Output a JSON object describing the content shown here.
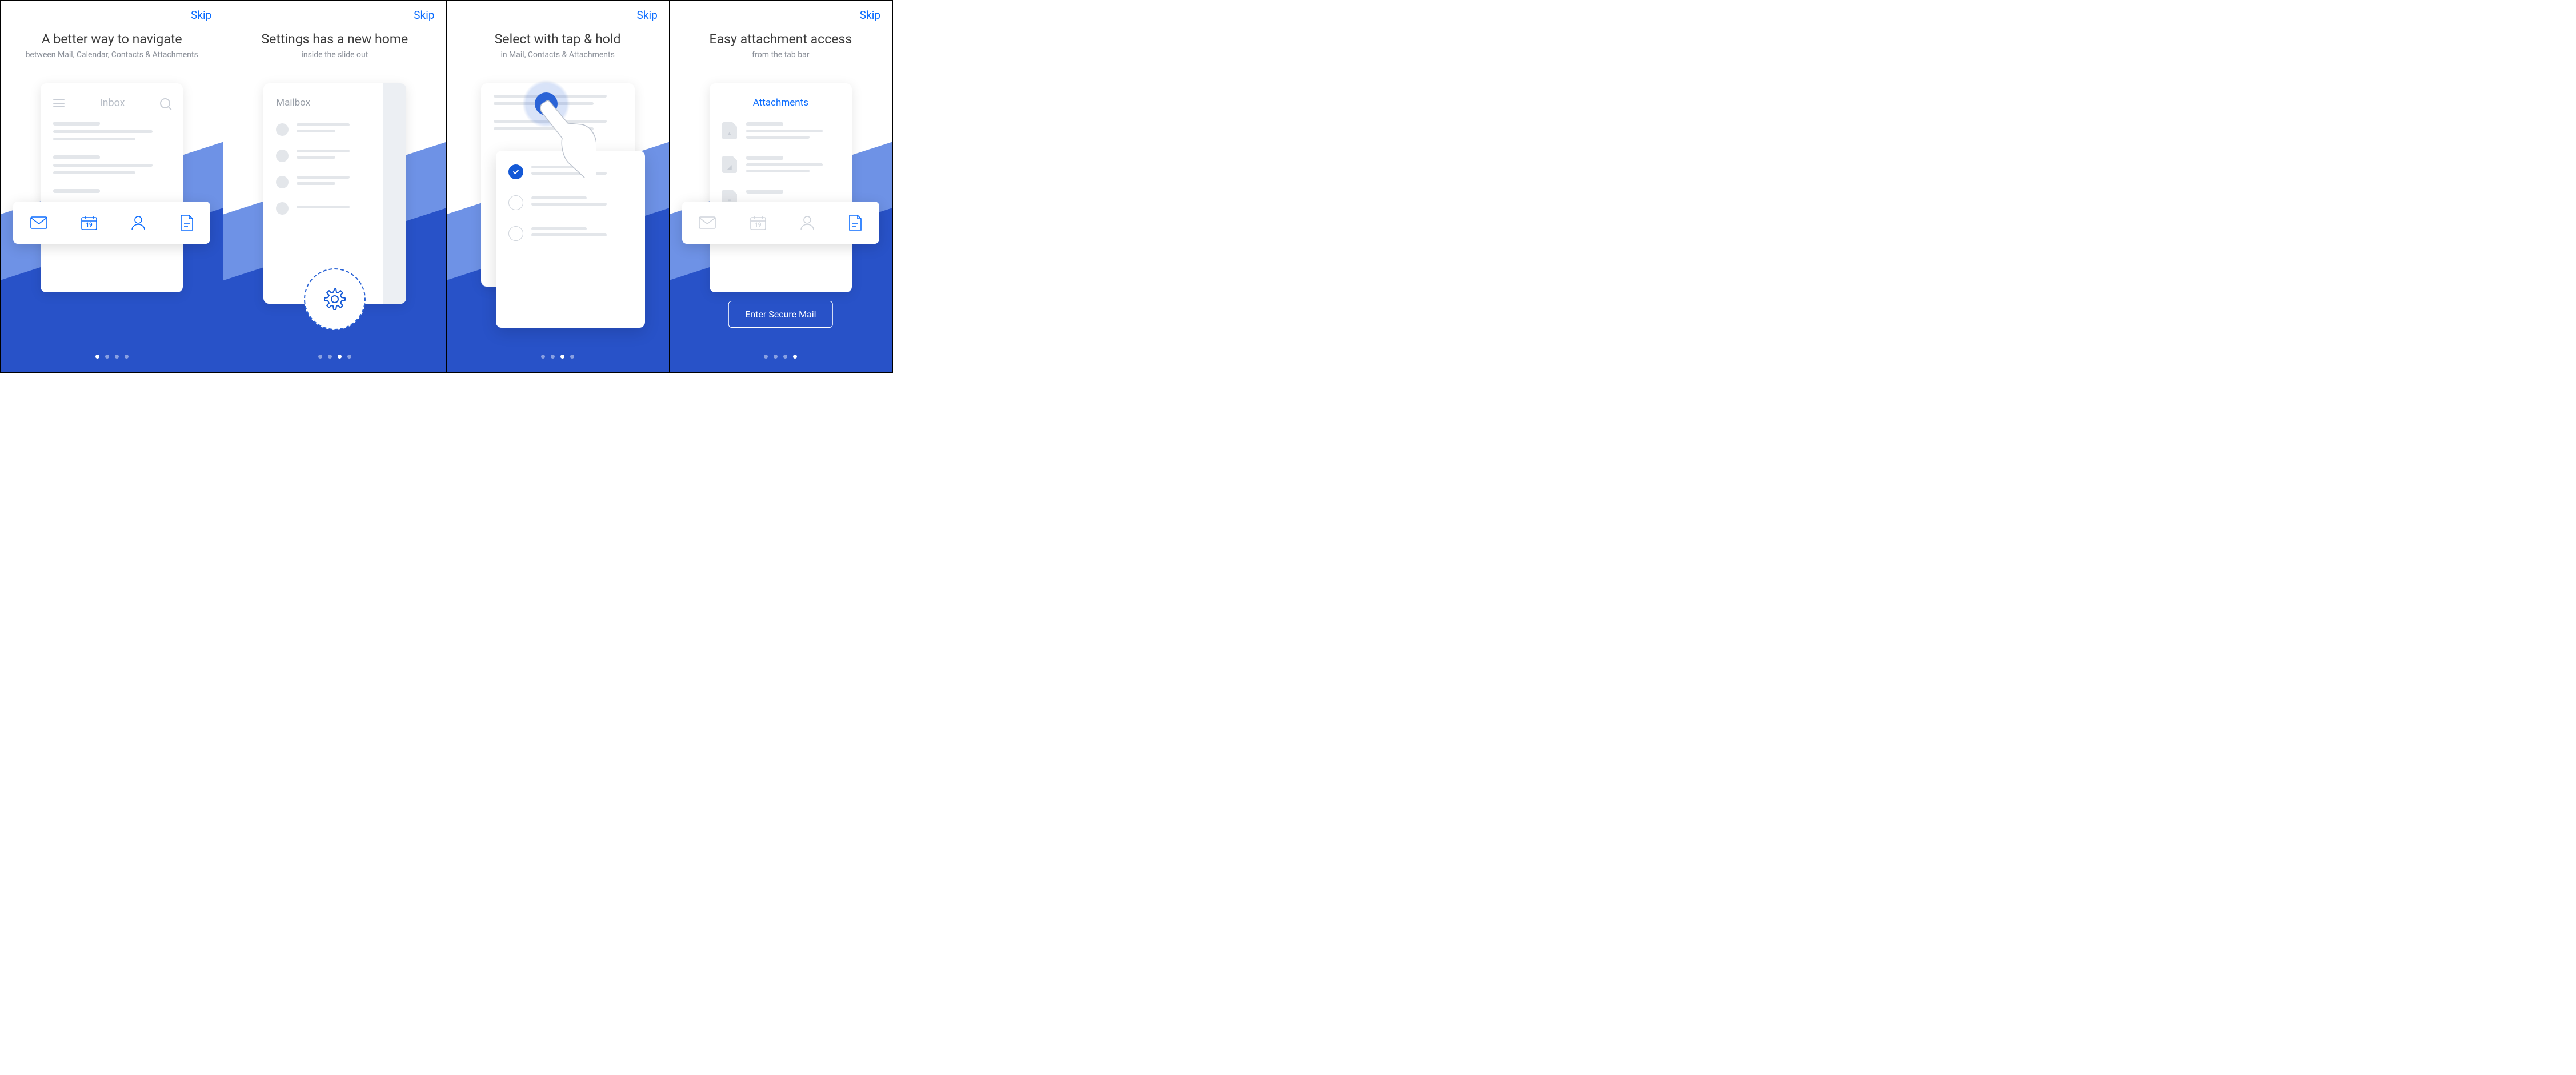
{
  "skip_label": "Skip",
  "screens": [
    {
      "title": "A better way to navigate",
      "subtitle": "between Mail, Calendar, Contacts & Attachments",
      "card_title": "Inbox",
      "active_dot": 0
    },
    {
      "title": "Settings has a new home",
      "subtitle": "inside the slide out",
      "card_title": "Mailbox",
      "active_dot": 2
    },
    {
      "title": "Select with tap & hold",
      "subtitle": "in Mail, Contacts & Attachments",
      "active_dot": 2
    },
    {
      "title": "Easy attachment access",
      "subtitle": "from the tab bar",
      "card_title": "Attachments",
      "enter_label": "Enter Secure Mail",
      "active_dot": 3
    }
  ],
  "tab_icons": [
    "mail-icon",
    "calendar-icon",
    "contacts-icon",
    "attachments-icon"
  ],
  "calendar_day": "19",
  "attachment_types": [
    "pdf-file-icon",
    "image-file-icon",
    "text-file-icon"
  ]
}
